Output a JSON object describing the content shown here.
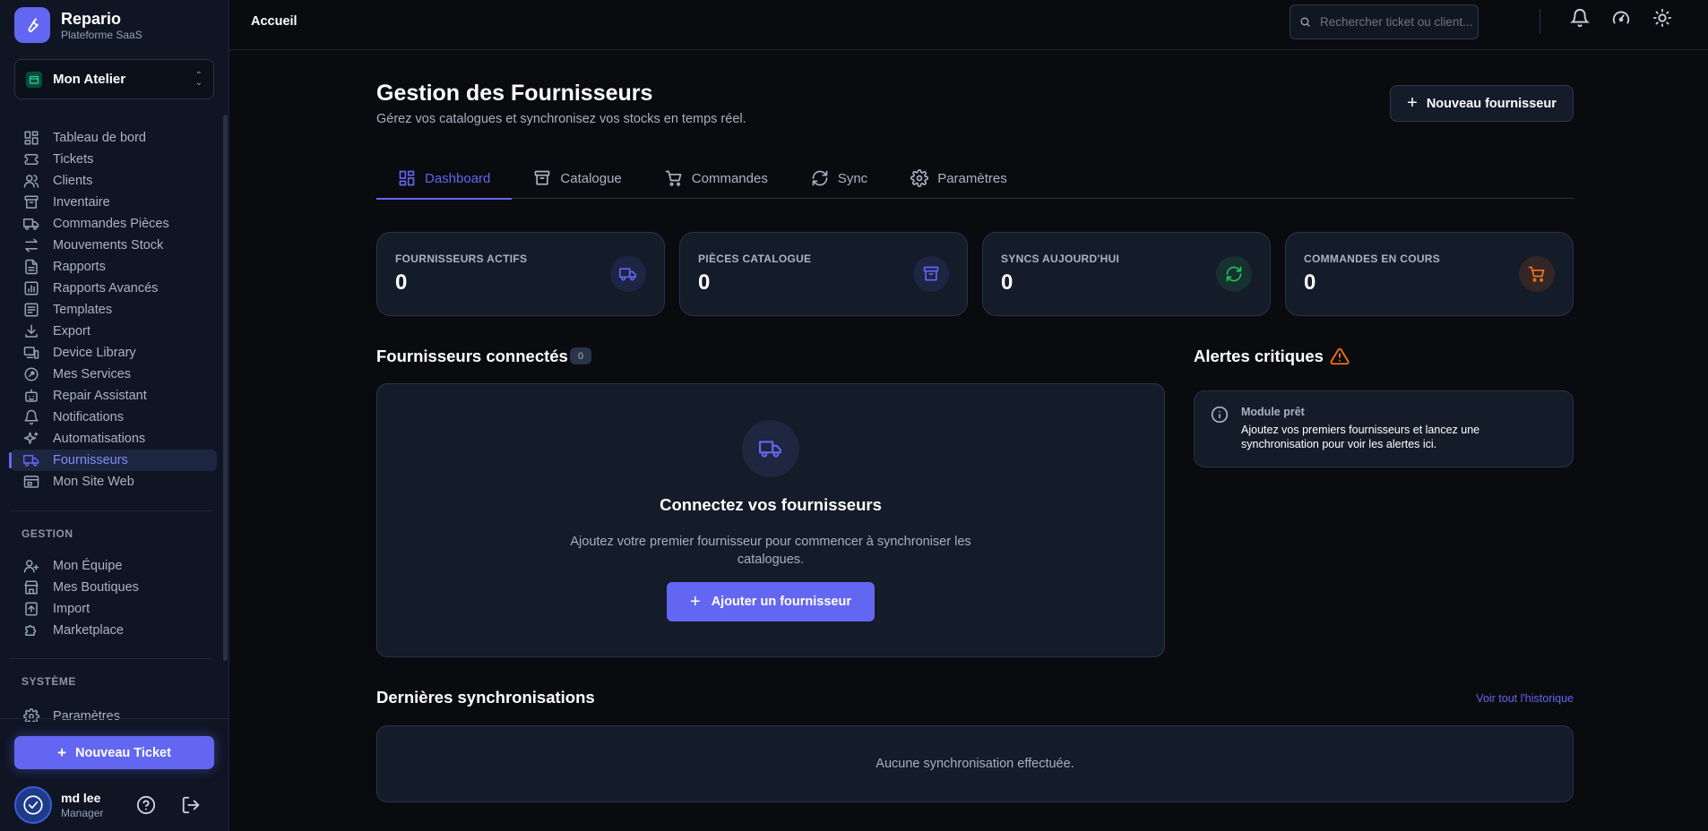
{
  "brand": {
    "name": "Repario",
    "subtitle": "Plateforme SaaS"
  },
  "workspace": {
    "label": "Mon Atelier"
  },
  "sidebar": {
    "items": [
      {
        "label": "Tableau de bord",
        "icon": "dashboard-icon"
      },
      {
        "label": "Tickets",
        "icon": "ticket-icon"
      },
      {
        "label": "Clients",
        "icon": "users-icon"
      },
      {
        "label": "Inventaire",
        "icon": "archive-icon"
      },
      {
        "label": "Commandes Pièces",
        "icon": "truck-icon"
      },
      {
        "label": "Mouvements Stock",
        "icon": "arrows-icon"
      },
      {
        "label": "Rapports",
        "icon": "file-icon"
      },
      {
        "label": "Rapports Avancés",
        "icon": "chart-icon"
      },
      {
        "label": "Templates",
        "icon": "template-icon"
      },
      {
        "label": "Export",
        "icon": "download-icon"
      },
      {
        "label": "Device Library",
        "icon": "devices-icon"
      },
      {
        "label": "Mes Services",
        "icon": "wrench-icon"
      },
      {
        "label": "Repair Assistant",
        "icon": "bot-icon"
      },
      {
        "label": "Notifications",
        "icon": "bell-icon"
      },
      {
        "label": "Automatisations",
        "icon": "sparkles-icon"
      },
      {
        "label": "Fournisseurs",
        "icon": "truck-icon",
        "active": true
      },
      {
        "label": "Mon Site Web",
        "icon": "browser-icon"
      }
    ],
    "gestion_label": "GESTION",
    "gestion": [
      {
        "label": "Mon Équipe",
        "icon": "team-icon"
      },
      {
        "label": "Mes Boutiques",
        "icon": "store-icon"
      },
      {
        "label": "Import",
        "icon": "upload-icon"
      },
      {
        "label": "Marketplace",
        "icon": "puzzle-icon"
      }
    ],
    "systeme_label": "SYSTÈME",
    "systeme": [
      {
        "label": "Paramètres",
        "icon": "gear-icon"
      }
    ],
    "new_ticket": "Nouveau Ticket"
  },
  "user": {
    "name": "md lee",
    "role": "Manager"
  },
  "topbar": {
    "breadcrumb": "Accueil",
    "search_placeholder": "Rechercher ticket ou client..."
  },
  "page": {
    "title": "Gestion des Fournisseurs",
    "subtitle": "Gérez vos catalogues et synchronisez vos stocks en temps réel.",
    "new_supplier": "Nouveau fournisseur"
  },
  "tabs": [
    {
      "label": "Dashboard",
      "icon": "grid-icon",
      "active": true
    },
    {
      "label": "Catalogue",
      "icon": "archive-icon"
    },
    {
      "label": "Commandes",
      "icon": "cart-icon"
    },
    {
      "label": "Sync",
      "icon": "sync-icon"
    },
    {
      "label": "Paramètres",
      "icon": "gear-icon"
    }
  ],
  "stats": [
    {
      "label": "FOURNISSEURS ACTIFS",
      "value": "0",
      "icon": "truck-icon",
      "color": "#6366f1"
    },
    {
      "label": "PIÈCES CATALOGUE",
      "value": "0",
      "icon": "archive-icon",
      "color": "#6366f1"
    },
    {
      "label": "SYNCS AUJOURD'HUI",
      "value": "0",
      "icon": "sync-icon",
      "color": "#22c55e"
    },
    {
      "label": "COMMANDES EN COURS",
      "value": "0",
      "icon": "cart-icon",
      "color": "#f97316"
    }
  ],
  "connected": {
    "title": "Fournisseurs connectés",
    "count": "0",
    "empty_title": "Connectez vos fournisseurs",
    "empty_text": "Ajoutez votre premier fournisseur pour commencer à synchroniser les catalogues.",
    "add_button": "Ajouter un fournisseur"
  },
  "alerts": {
    "title": "Alertes critiques",
    "item_title": "Module prêt",
    "item_text": "Ajoutez vos premiers fournisseurs et lancez une synchronisation pour voir les alertes ici."
  },
  "syncs": {
    "title": "Dernières synchronisations",
    "link": "Voir tout l'historique",
    "empty": "Aucune synchronisation effectuée."
  },
  "colors": {
    "accent": "#6366f1",
    "warning": "#f97316",
    "success": "#22c55e",
    "background": "#0a0b0f",
    "panel": "#141b29"
  }
}
